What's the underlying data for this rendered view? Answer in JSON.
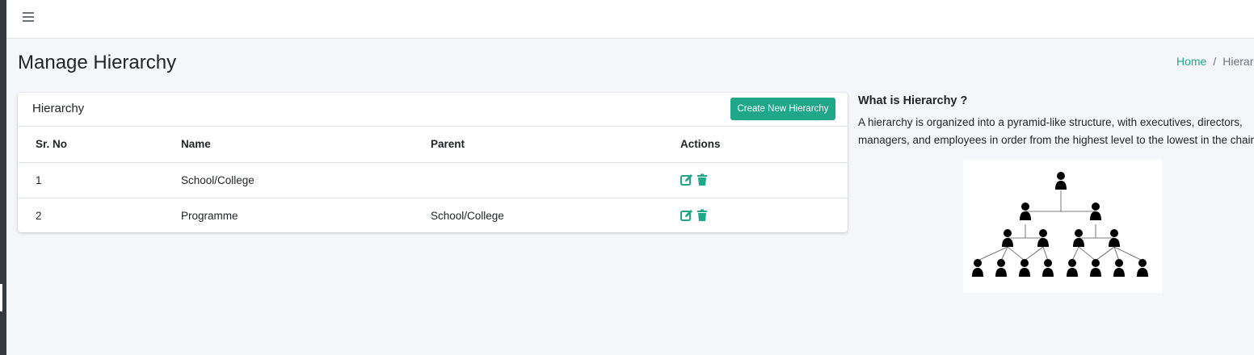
{
  "page": {
    "title": "Manage Hierarchy"
  },
  "breadcrumb": {
    "home": "Home",
    "separator": "/",
    "current": "Hierarchy"
  },
  "card": {
    "title": "Hierarchy",
    "create_button": "Create New Hierarchy",
    "columns": [
      "Sr. No",
      "Name",
      "Parent",
      "Actions"
    ],
    "rows": [
      {
        "sr": "1",
        "name": "School/College",
        "parent": ""
      },
      {
        "sr": "2",
        "name": "Programme",
        "parent": "School/College"
      }
    ]
  },
  "info": {
    "title": "What is Hierarchy ?",
    "text_line1": "A hierarchy is organized into a pyramid-like structure, with executives, directors,",
    "text_line2": "managers, and employees in order from the highest level to the lowest in the chain"
  },
  "icons": {
    "menu": "hamburger-icon",
    "edit": "edit-icon",
    "delete": "trash-icon"
  },
  "colors": {
    "accent": "#20a78a",
    "background": "#f4f6f9"
  }
}
